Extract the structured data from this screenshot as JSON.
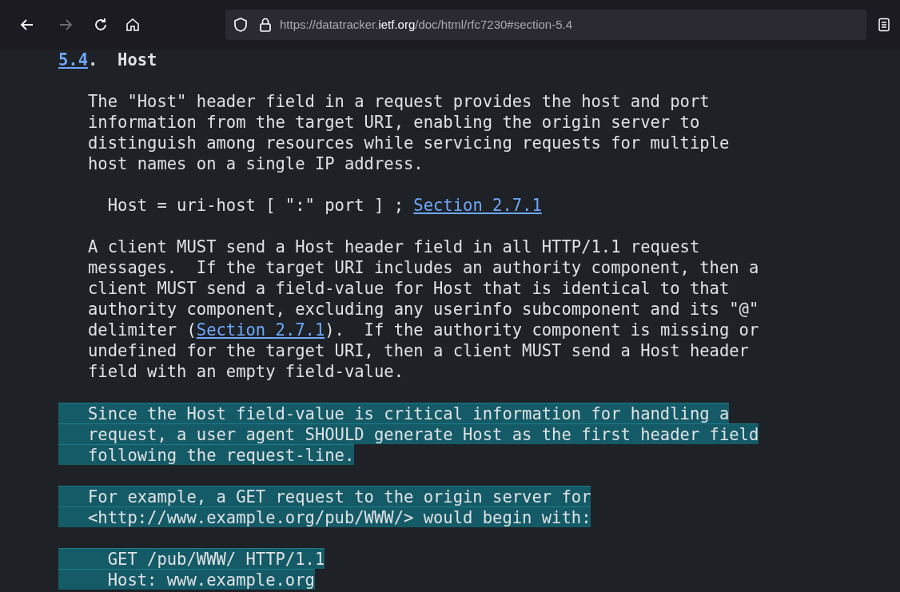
{
  "toolbar": {
    "back_disabled": false,
    "forward_disabled": true,
    "url": {
      "scheme_host_prefix": "https://datatracker.",
      "domain": "ietf.org",
      "path": "/doc/html/rfc7230#section-5.4"
    }
  },
  "heading": {
    "number": "5.4",
    "separator": ".  ",
    "title": "Host"
  },
  "blocks": [
    {
      "selected": false,
      "lines": [
        "   The \"Host\" header field in a request provides the host and port",
        "   information from the target URI, enabling the origin server to",
        "   distinguish among resources while servicing requests for multiple",
        "   host names on a single IP address."
      ]
    },
    {
      "selected": false,
      "lines": [
        [
          {
            "kind": "text",
            "text": "     Host = uri-host [ \":\" port ] ; "
          },
          {
            "kind": "link",
            "text": "Section 2.7.1"
          }
        ]
      ]
    },
    {
      "selected": false,
      "lines": [
        "   A client MUST send a Host header field in all HTTP/1.1 request",
        "   messages.  If the target URI includes an authority component, then a",
        "   client MUST send a field-value for Host that is identical to that",
        "   authority component, excluding any userinfo subcomponent and its \"@\"",
        [
          {
            "kind": "text",
            "text": "   delimiter ("
          },
          {
            "kind": "link",
            "text": "Section 2.7.1"
          },
          {
            "kind": "text",
            "text": ").  If the authority component is missing or"
          }
        ],
        "   undefined for the target URI, then a client MUST send a Host header",
        "   field with an empty field-value."
      ]
    },
    {
      "selected": true,
      "lines": [
        "   Since the Host field-value is critical information for handling a",
        "   request, a user agent SHOULD generate Host as the first header field",
        "   following the request-line."
      ]
    },
    {
      "selected": true,
      "lines": [
        "   For example, a GET request to the origin server for",
        "   <http://www.example.org/pub/WWW/> would begin with:"
      ]
    },
    {
      "selected": true,
      "lines": [
        "     GET /pub/WWW/ HTTP/1.1",
        "     Host: www.example.org"
      ]
    }
  ]
}
